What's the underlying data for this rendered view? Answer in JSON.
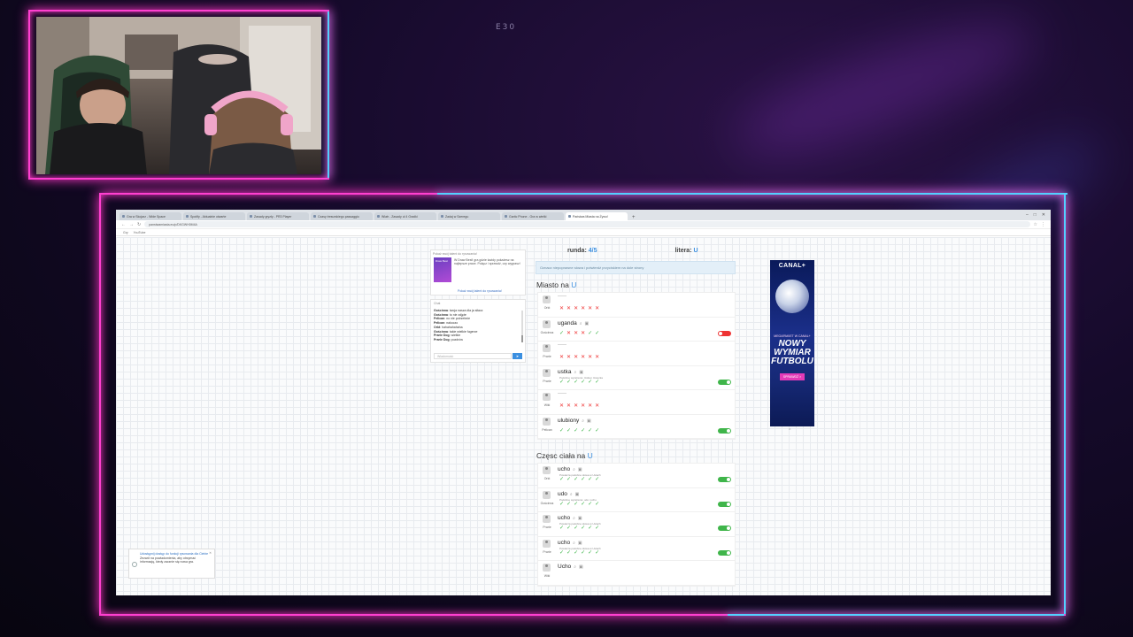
{
  "overlay": {
    "label": "E30"
  },
  "browser": {
    "tabs": [
      "Gra w Skojarz - Wide Space",
      "Spotify - Aktualnie otwarte",
      "Zasady gryzły - PR3 Player",
      "Czasy tresurskiego passaggio",
      "Wiatr - Zasady ul 4 Gradki",
      "Zadaj w Szeregu",
      "Gartic Phone - Gra w wielki",
      "Państwa Miasta na Żywo!"
    ],
    "new_tab": "+",
    "window_controls": [
      "–",
      "□",
      "✕"
    ],
    "url": "panstwamiasta.eu/p/DKGWH0M4A",
    "bookmarks": [
      "Gry",
      "YouTube"
    ]
  },
  "promo": {
    "title": "Pokaż swój talent do rysowania!",
    "body": "W Draw Best! gra gdzie każdy pokażesz na najlepsze prace. Połącz i sprawdź, czy wygrasz!",
    "button": "Pokaż swój talent do rysowania!",
    "image_caption": "Draw Best"
  },
  "chat": {
    "title": "Chat",
    "messages": [
      {
        "name": "Gościnna",
        "text": "twoja nasza dla ja siłacz"
      },
      {
        "name": "Gościnna",
        "text": "to nie zdjęte"
      },
      {
        "name": "Pelican",
        "text": "no nie potrzebnie"
      },
      {
        "name": "Pelican",
        "text": "nakoczo"
      },
      {
        "name": "Orkt",
        "text": "hahahahahaha"
      },
      {
        "name": "Gościnna",
        "text": "takie wielkie fugerze"
      },
      {
        "name": "Prarie Dog",
        "text": "wielkie"
      },
      {
        "name": "Prarie Dog",
        "text": "pozdrów"
      }
    ],
    "input_placeholder": "Wiadomość",
    "send_label": "➤"
  },
  "game": {
    "round_label": "runda:",
    "round_value": "4/5",
    "letter_label": "litera:",
    "letter_value": "U",
    "info": "Oznacz niepoprawne słowa i potwierdź przyciskiem na dole strony",
    "categories": [
      {
        "title": "Miasto na",
        "letter": "U",
        "answers": [
          {
            "player": "Orkt",
            "word": "——",
            "note": "",
            "votes": [
              "x",
              "x",
              "x",
              "x",
              "x",
              "x"
            ],
            "toggle": ""
          },
          {
            "player": "Gościnna",
            "word": "uganda",
            "note": "",
            "votes": [
              "ok",
              "x",
              "x",
              "x",
              "ok",
              "ok"
            ],
            "toggle": "off"
          },
          {
            "player": "Prarie",
            "word": "——",
            "note": "",
            "votes": [
              "x",
              "x",
              "x",
              "x",
              "x",
              "x"
            ],
            "toggle": ""
          },
          {
            "player": "Prarie",
            "word": "ustka",
            "note": "Podobne wyrażenie: Ustka i Ustecka",
            "votes": [
              "ok",
              "ok",
              "ok",
              "ok",
              "ok",
              "ok"
            ],
            "toggle": "on"
          },
          {
            "player": "Wiki",
            "word": "——",
            "note": "",
            "votes": [
              "x",
              "x",
              "x",
              "x",
              "x",
              "x"
            ],
            "toggle": ""
          },
          {
            "player": "Pelican",
            "word": "ulubiony",
            "note": "",
            "votes": [
              "ok",
              "ok",
              "ok",
              "ok",
              "ok",
              "ok"
            ],
            "toggle": "on"
          }
        ]
      },
      {
        "title": "Częsc ciała na",
        "letter": "U",
        "answers": [
          {
            "player": "Orkt",
            "word": "ucho",
            "note": "Powtarza podobne słowa w Ustach",
            "votes": [
              "ok",
              "ok",
              "ok",
              "ok",
              "ok",
              "ok"
            ],
            "toggle": "on"
          },
          {
            "player": "Gościnna",
            "word": "udo",
            "note": "Podobne wyrażenie: udo i ucho",
            "votes": [
              "ok",
              "ok",
              "ok",
              "ok",
              "ok",
              "ok"
            ],
            "toggle": "on"
          },
          {
            "player": "Prarie",
            "word": "ucho",
            "note": "Powtarza podobne słowa w Ustach",
            "votes": [
              "ok",
              "ok",
              "ok",
              "ok",
              "ok",
              "ok"
            ],
            "toggle": "on"
          },
          {
            "player": "Prarie",
            "word": "ucho",
            "note": "Powtarza podobne słowa w Ustach",
            "votes": [
              "ok",
              "ok",
              "ok",
              "ok",
              "ok",
              "ok"
            ],
            "toggle": "on"
          },
          {
            "player": "Wiki",
            "word": "Ucho",
            "note": "",
            "votes": [],
            "toggle": ""
          }
        ]
      }
    ]
  },
  "ad": {
    "brand": "CANAL+",
    "tagline": "MEGAPAKIET W CANAL+",
    "headline": "NOWY WYMIAR FUTBOLU",
    "cta": "SPRAWDŹ >",
    "close": "^"
  },
  "notification": {
    "link": "Udostępnij dostęp do funkcji rysowania dla Ciebie",
    "body": "Zezwól na powiadomienia, aby otrzymać informację, kiedy zacznie się nowa gra.",
    "close": "✕"
  },
  "colors": {
    "accent": "#3b8fe0",
    "ok": "#3fb54a",
    "wrong": "#e33333",
    "neon_pink": "#ff3fd0",
    "neon_cyan": "#53d0ff"
  }
}
